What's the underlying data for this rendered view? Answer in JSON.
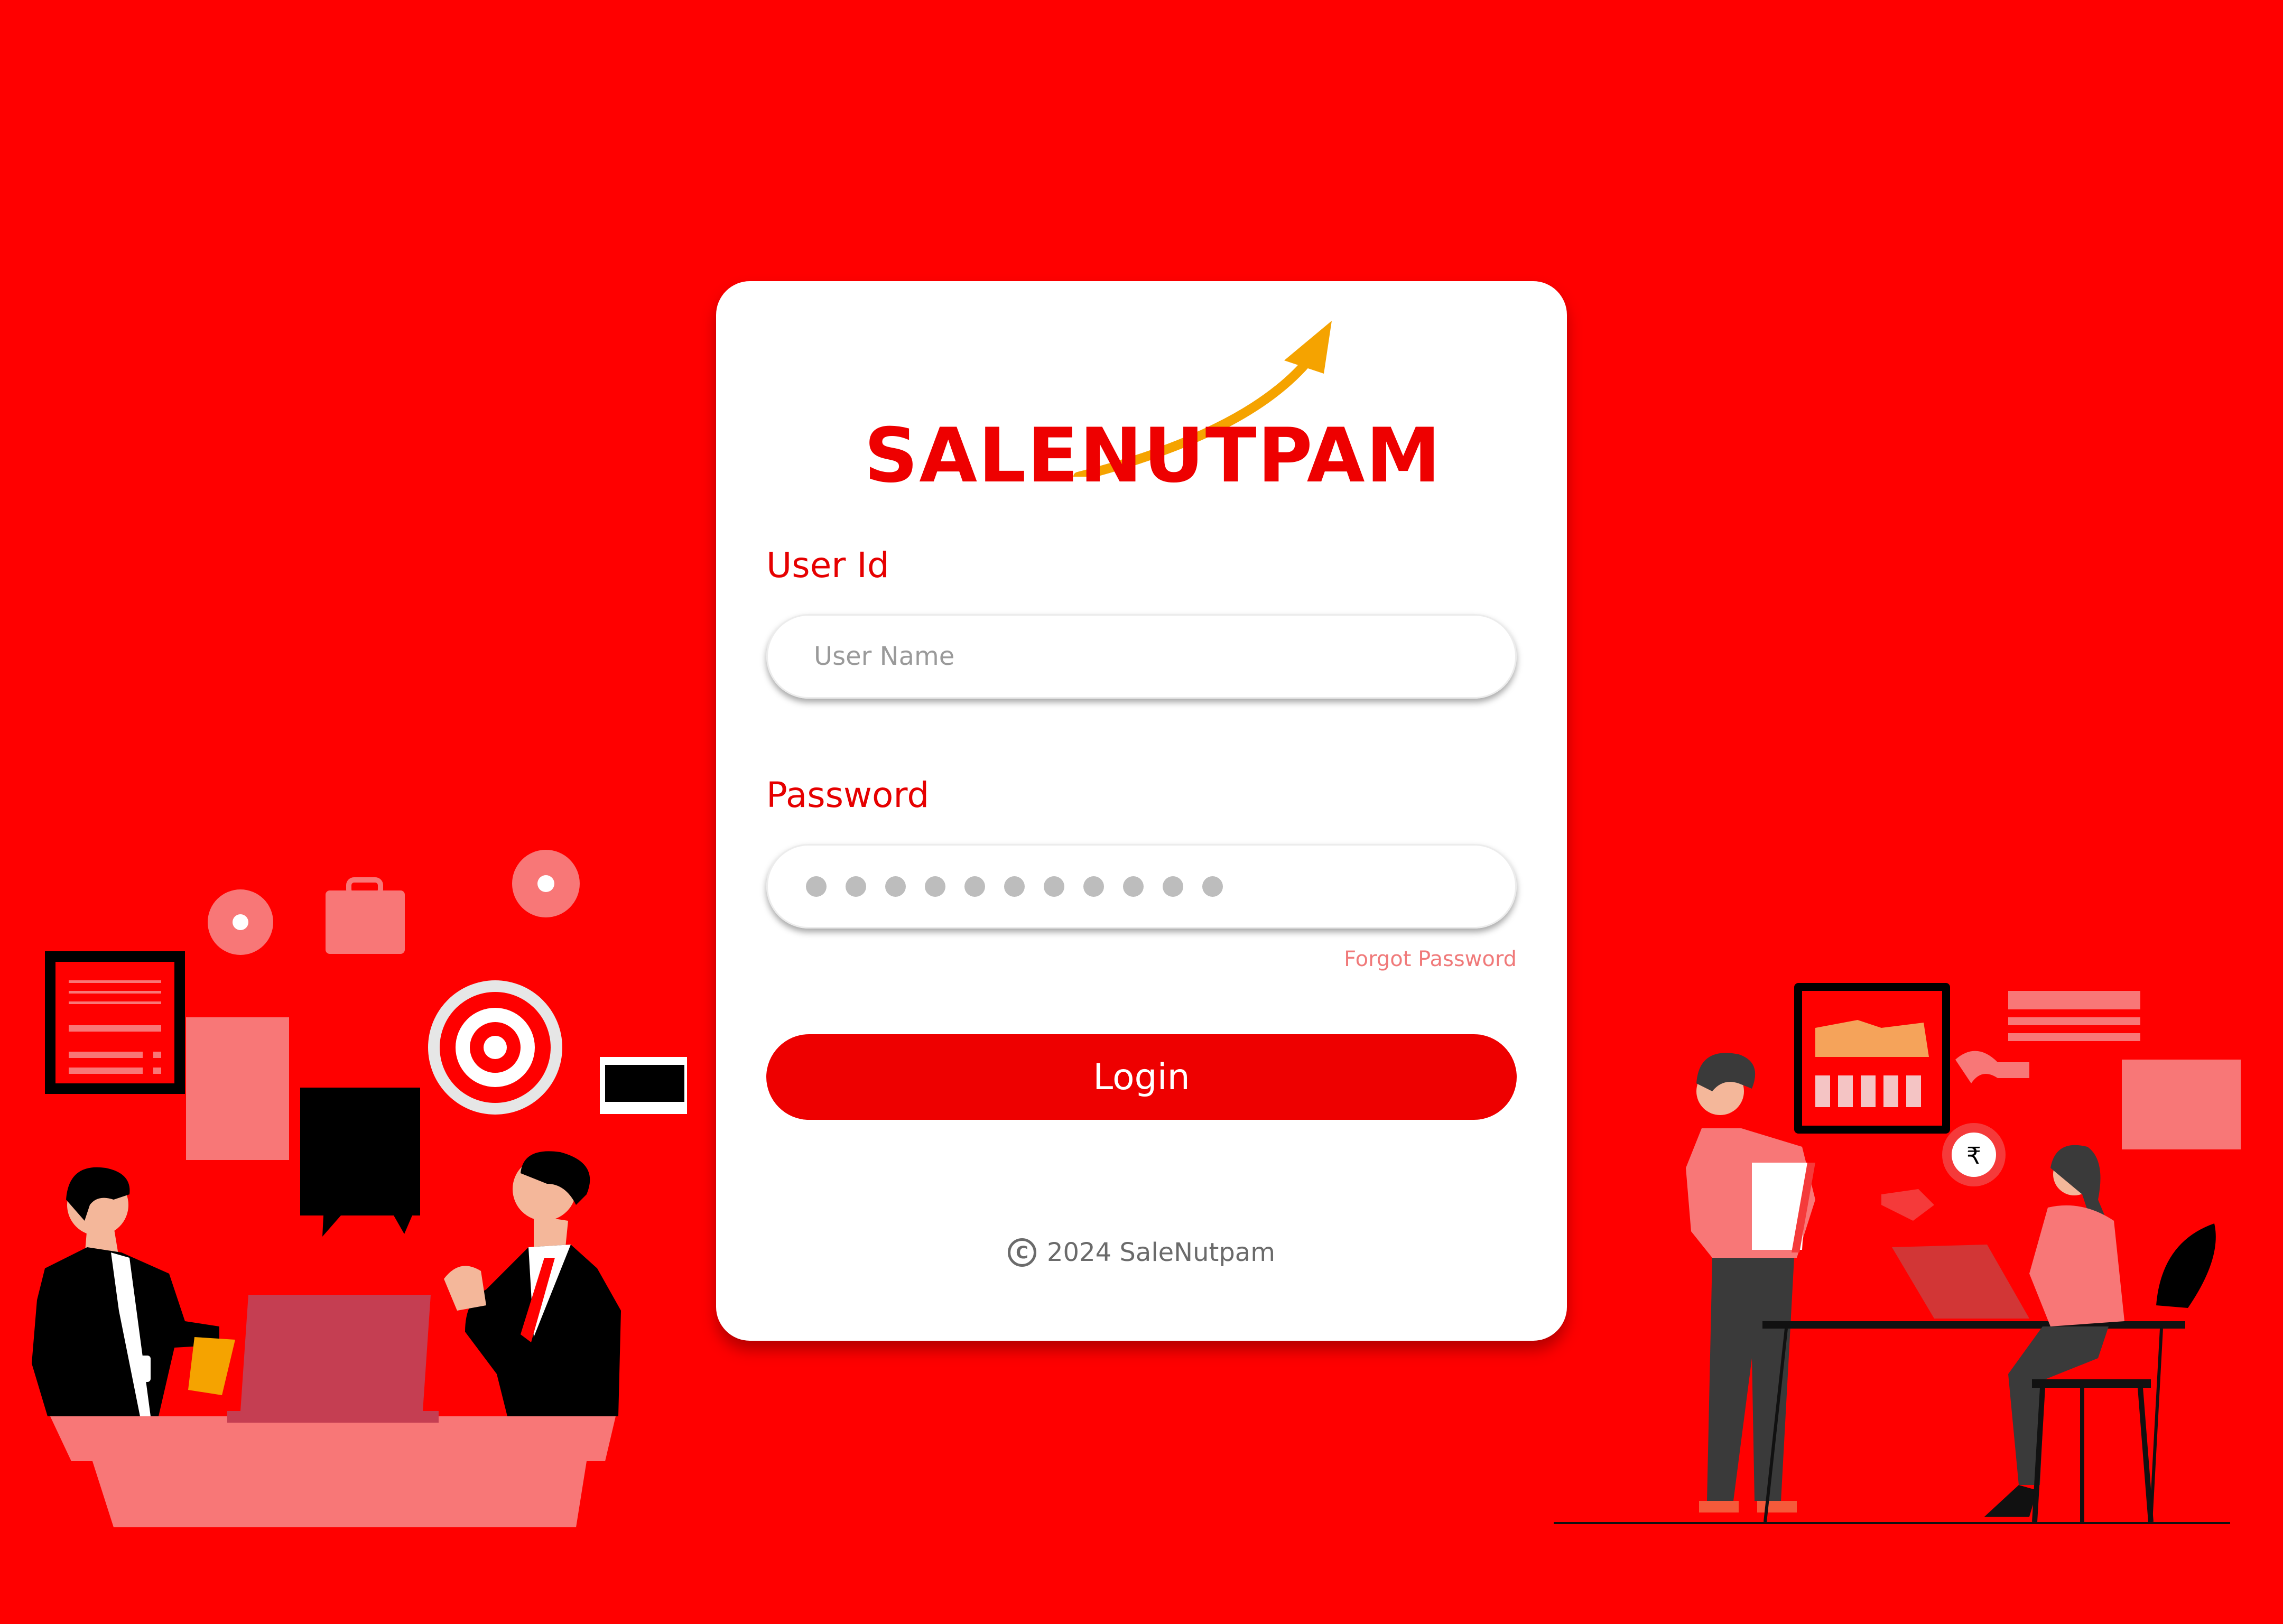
{
  "brand": {
    "logo_text": "SALENUTPAM",
    "primary_color": "#ee0000",
    "arrow_color": "#f5a300"
  },
  "form": {
    "user_label": "User Id",
    "user_placeholder": "User Name",
    "user_value": "",
    "password_label": "Password",
    "password_mask_length": 11,
    "forgot_label": "Forgot Password",
    "login_label": "Login"
  },
  "footer": {
    "copyright_icon": "copyright-icon",
    "copyright_text": "2024 SaleNutpam"
  }
}
